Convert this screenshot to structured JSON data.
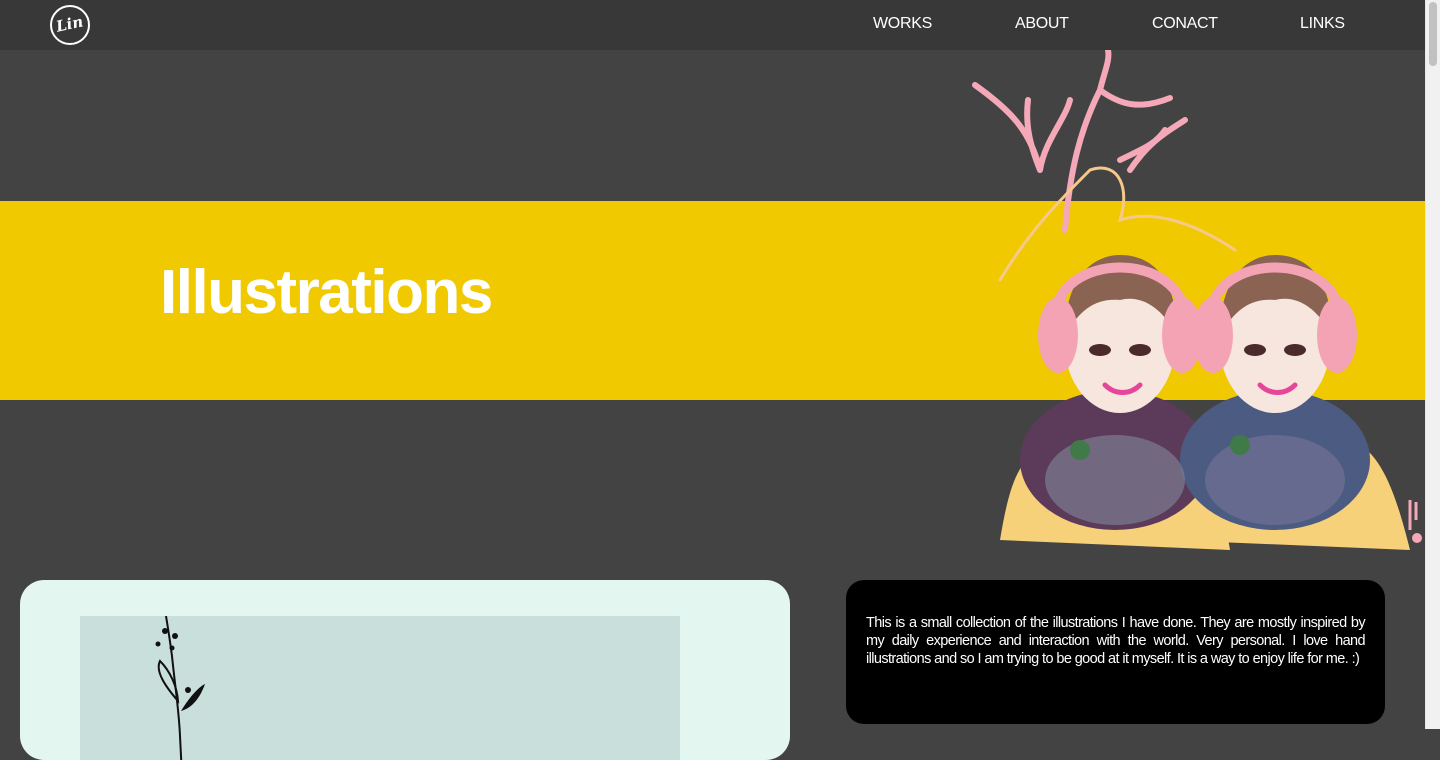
{
  "nav": {
    "logo_text": "Lin",
    "links": [
      "WORKS",
      "ABOUT",
      "CONACT",
      "LINKS"
    ]
  },
  "hero": {
    "title": "Illustrations"
  },
  "description": {
    "text": "This is a small collection of the illustrations I have done. They are mostly inspired by my daily experience and interaction with the world. Very personal. I love hand illustrations and so I am trying to be good at it myself. It is a way to enjoy life for me. :)"
  },
  "colors": {
    "topbar": "#383838",
    "page_background": "#434343",
    "hero_band": "#f0c900",
    "card_light": "#e4f6f0",
    "card_dark": "#000000"
  }
}
